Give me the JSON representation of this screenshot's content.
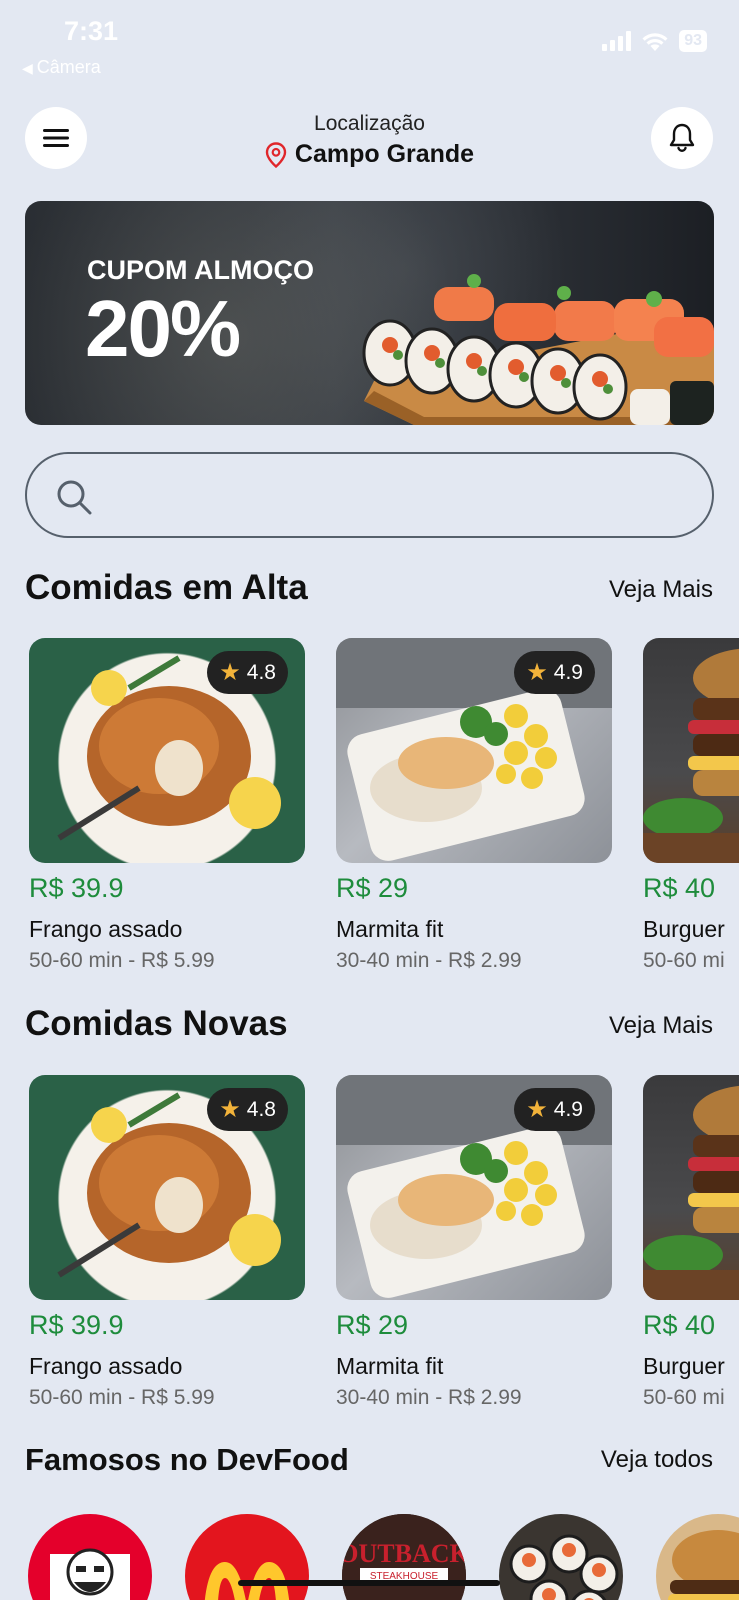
{
  "status_bar": {
    "time": "7:31",
    "back_app": "Câmera",
    "battery": "93"
  },
  "header": {
    "location_label": "Localização",
    "city": "Campo Grande",
    "menu_icon": "hamburger-menu-icon",
    "notification_icon": "bell-icon",
    "location_icon": "map-pin-icon"
  },
  "banner": {
    "kicker": "CUPOM ALMOÇO",
    "discount": "20%"
  },
  "search": {
    "placeholder": "",
    "value": ""
  },
  "sections": {
    "trending": {
      "title": "Comidas em Alta",
      "link": "Veja Mais"
    },
    "new": {
      "title": "Comidas Novas",
      "link": "Veja Mais"
    },
    "famous": {
      "title": "Famosos no DevFood",
      "link": "Veja todos"
    }
  },
  "foods": [
    {
      "price": "R$ 39.9",
      "name": "Frango assado",
      "meta": "50-60 min - R$ 5.99",
      "rating": "4.8"
    },
    {
      "price": "R$ 29",
      "name": "Marmita fit",
      "meta": "30-40 min - R$ 2.99",
      "rating": "4.9"
    },
    {
      "price": "R$ 40",
      "name": "Burguer",
      "meta": "50-60 mi",
      "rating": ""
    }
  ],
  "famous_brands": [
    {
      "name": "KFC"
    },
    {
      "name": "McDonald's"
    },
    {
      "name": "OUTBACK",
      "sub": "STEAKHOUSE"
    },
    {
      "name": "Sushi"
    },
    {
      "name": "Burger"
    }
  ],
  "colors": {
    "background": "#e3e8f2",
    "price_green": "#1e8c3c",
    "pin_red": "#e0262b",
    "star": "#f2b33a"
  }
}
